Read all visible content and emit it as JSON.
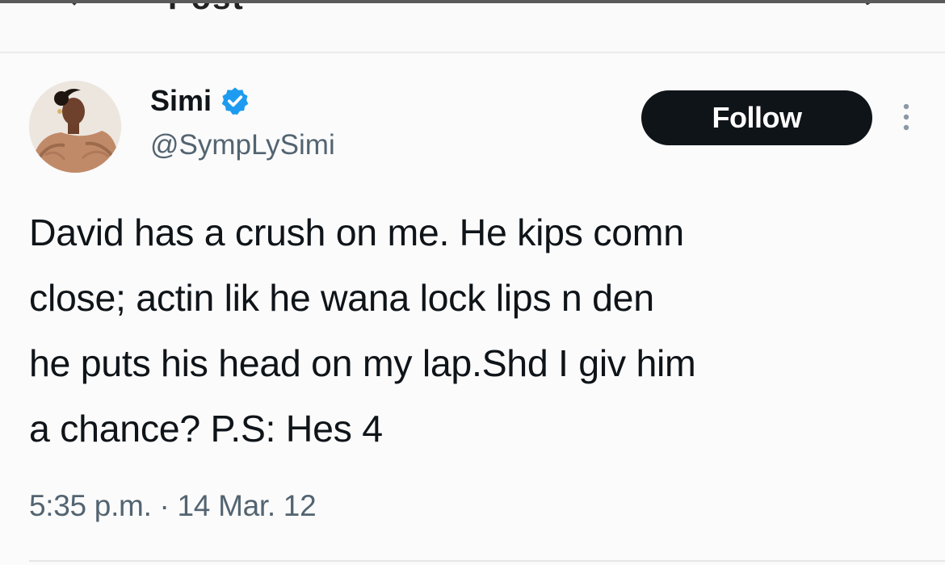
{
  "header": {
    "title": "Post"
  },
  "tweet": {
    "author": {
      "name": "Simi",
      "handle": "@SympLySimi",
      "verified": true
    },
    "follow_label": "Follow",
    "text_lines": [
      "David has a crush on me. He kips comn",
      "close; actin lik he wana lock lips n den",
      "he puts his head on my lap.Shd I giv him",
      "a chance? P.S: Hes 4"
    ],
    "timestamp": "5:35 p.m. · 14 Mar. 12"
  },
  "icons": {
    "back": "back-arrow-icon",
    "reply": "reply-icon",
    "verified": "verified-badge-icon",
    "more": "more-options-icon"
  },
  "colors": {
    "primary_text": "#0f1419",
    "secondary_text": "#536471",
    "verified_blue": "#1d9bf0",
    "follow_bg": "#0f1419",
    "follow_text": "#ffffff"
  }
}
